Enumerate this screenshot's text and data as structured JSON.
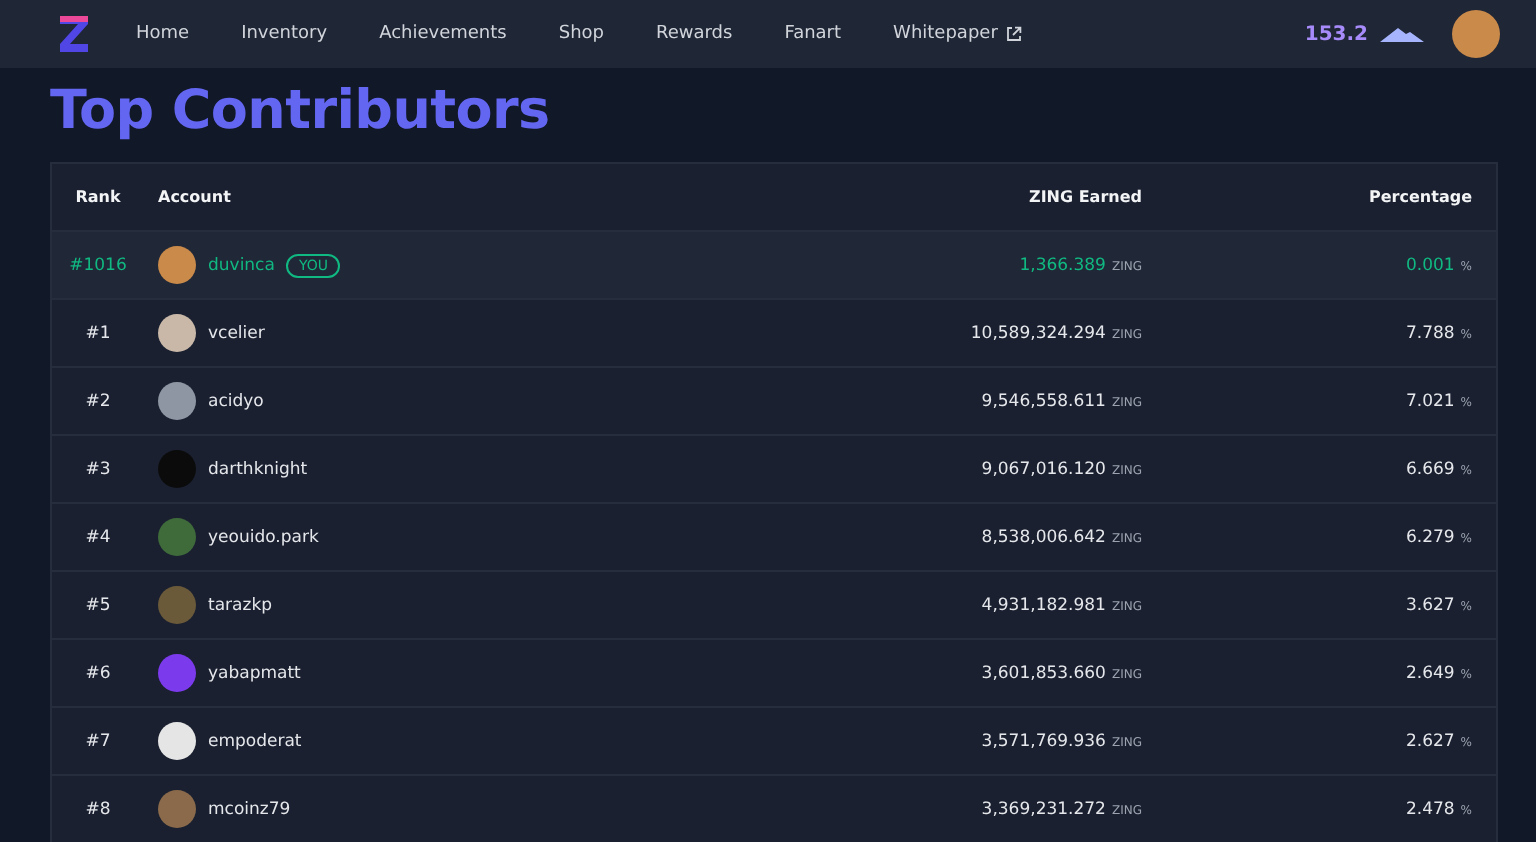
{
  "nav": {
    "items": [
      {
        "label": "Home",
        "external": false
      },
      {
        "label": "Inventory",
        "external": false
      },
      {
        "label": "Achievements",
        "external": false
      },
      {
        "label": "Shop",
        "external": false
      },
      {
        "label": "Rewards",
        "external": false
      },
      {
        "label": "Fanart",
        "external": false
      },
      {
        "label": "Whitepaper",
        "external": true
      }
    ],
    "balance": "153.2"
  },
  "title": "Top Contributors",
  "table": {
    "columns": [
      "Rank",
      "Account",
      "ZING Earned",
      "Percentage"
    ],
    "rows": [
      {
        "rank": "#1016",
        "account": "duvinca",
        "badge": "YOU",
        "is_you": true,
        "earned": "1,366.389",
        "earned_unit": "ZING",
        "percentage": "0.001",
        "percentage_unit": "%"
      },
      {
        "rank": "#1",
        "account": "vcelier",
        "is_you": false,
        "earned": "10,589,324.294",
        "earned_unit": "ZING",
        "percentage": "7.788",
        "percentage_unit": "%"
      },
      {
        "rank": "#2",
        "account": "acidyo",
        "is_you": false,
        "earned": "9,546,558.611",
        "earned_unit": "ZING",
        "percentage": "7.021",
        "percentage_unit": "%"
      },
      {
        "rank": "#3",
        "account": "darthknight",
        "is_you": false,
        "earned": "9,067,016.120",
        "earned_unit": "ZING",
        "percentage": "6.669",
        "percentage_unit": "%"
      },
      {
        "rank": "#4",
        "account": "yeouido.park",
        "is_you": false,
        "earned": "8,538,006.642",
        "earned_unit": "ZING",
        "percentage": "6.279",
        "percentage_unit": "%"
      },
      {
        "rank": "#5",
        "account": "tarazkp",
        "is_you": false,
        "earned": "4,931,182.981",
        "earned_unit": "ZING",
        "percentage": "3.627",
        "percentage_unit": "%"
      },
      {
        "rank": "#6",
        "account": "yabapmatt",
        "is_you": false,
        "earned": "3,601,853.660",
        "earned_unit": "ZING",
        "percentage": "2.649",
        "percentage_unit": "%"
      },
      {
        "rank": "#7",
        "account": "empoderat",
        "is_you": false,
        "earned": "3,571,769.936",
        "earned_unit": "ZING",
        "percentage": "2.627",
        "percentage_unit": "%"
      },
      {
        "rank": "#8",
        "account": "mcoinz79",
        "is_you": false,
        "earned": "3,369,231.272",
        "earned_unit": "ZING",
        "percentage": "2.478",
        "percentage_unit": "%"
      }
    ]
  }
}
